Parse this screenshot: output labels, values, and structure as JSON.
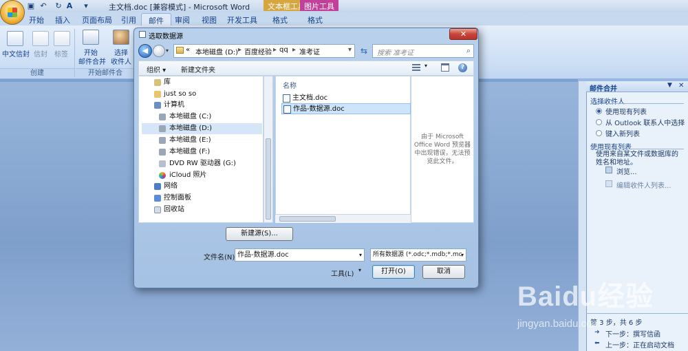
{
  "app": {
    "title": "主文档.doc [兼容模式] - Microsoft Word",
    "context_tabs": [
      "文本框工具",
      "图片工具"
    ]
  },
  "ribbon": {
    "tabs": [
      "开始",
      "插入",
      "页面布局",
      "引用",
      "邮件",
      "审阅",
      "视图",
      "开发工具",
      "格式",
      "格式"
    ],
    "active_tab": "邮件",
    "buttons": {
      "chinese_envelope": "中文信封",
      "envelope": "信封",
      "labels": "标签",
      "start_merge_line1": "开始",
      "start_merge_line2": "邮件合并",
      "select_recipients_line1": "选择",
      "select_recipients_line2": "收件人"
    },
    "groups": {
      "create": "创建",
      "start_merge": "开始邮件合"
    }
  },
  "dialog": {
    "title": "选取数据源",
    "close_label": "✕",
    "breadcrumbs": [
      "«",
      "本地磁盘 (D:)",
      "百度经验",
      "qq",
      "准考证"
    ],
    "search_placeholder": "搜索 准考证",
    "toolbar": {
      "organize": "组织 ▾",
      "new_folder": "新建文件夹"
    },
    "nav_items": [
      {
        "label": "库",
        "icon": "library-icon"
      },
      {
        "label": "just so so",
        "icon": "folder-icon"
      },
      {
        "label": "计算机",
        "icon": "computer-icon"
      },
      {
        "label": "本地磁盘 (C:)",
        "icon": "system-drive-icon"
      },
      {
        "label": "本地磁盘 (D:)",
        "icon": "drive-icon"
      },
      {
        "label": "本地磁盘 (E:)",
        "icon": "drive-icon"
      },
      {
        "label": "本地磁盘 (F:)",
        "icon": "drive-icon"
      },
      {
        "label": "DVD RW 驱动器 (G:)",
        "icon": "dvd-drive-icon"
      },
      {
        "label": "iCloud 照片",
        "icon": "icloud-icon"
      },
      {
        "label": "网络",
        "icon": "network-icon"
      },
      {
        "label": "控制面板",
        "icon": "control-panel-icon"
      },
      {
        "label": "回收站",
        "icon": "recycle-bin-icon"
      }
    ],
    "selected_nav": "本地磁盘 (D:)",
    "file_column_header": "名称",
    "files": [
      "主文档.doc",
      "作品-数据源.doc"
    ],
    "selected_file": "作品-数据源.doc",
    "preview_message": "由于 Microsoft Office Word 预览器中出现错误，无法预览此文件。",
    "new_source_button": "新建源(S)...",
    "filename_label": "文件名(N):",
    "filename_value": "作品-数据源.doc",
    "filetype_value": "所有数据源 (*.odc;*.mdb;*.mc",
    "tools_label": "工具(L)",
    "open_button": "打开(O)",
    "cancel_button": "取消"
  },
  "task_pane": {
    "title": "邮件合并",
    "section1": "选择收件人",
    "options": [
      "使用现有列表",
      "从 Outlook 联系人中选择",
      "键入新列表"
    ],
    "selected_option": "使用现有列表",
    "section2": "使用现有列表",
    "description": "使用来自某文件或数据库的姓名和地址。",
    "browse": "浏览...",
    "edit_list": "编辑收件人列表...",
    "step": "第 3 步，共 6 步",
    "next_step": "下一步：撰写信函",
    "prev_step": "上一步：正在启动文档"
  },
  "watermark": {
    "brand": "Baidu经验",
    "url": "jingyan.baidu.com"
  },
  "colors": {
    "ribbon_text": "#15428b",
    "dialog_frame": "#a5c1e3",
    "close_red": "#c9453a"
  }
}
